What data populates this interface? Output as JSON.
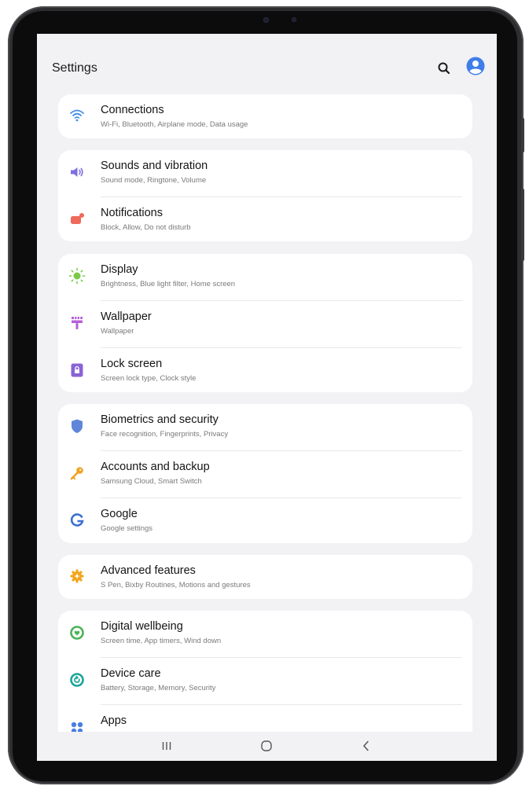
{
  "appbar": {
    "title": "Settings",
    "search_icon": "search-icon",
    "account_icon": "account-circle-icon"
  },
  "colors": {
    "screen_bg": "#f2f2f4",
    "card_bg": "#ffffff",
    "accent_blue": "#3f7ee8"
  },
  "groups": [
    {
      "items": [
        {
          "label": "Connections",
          "sub": "Wi-Fi, Bluetooth, Airplane mode, Data usage",
          "icon": "wifi-icon",
          "color": "#3f8ee8"
        }
      ]
    },
    {
      "items": [
        {
          "label": "Sounds and vibration",
          "sub": "Sound mode, Ringtone, Volume",
          "icon": "speaker-icon",
          "color": "#7d6fe0"
        },
        {
          "label": "Notifications",
          "sub": "Block, Allow, Do not disturb",
          "icon": "notification-icon",
          "color": "#ee6a5a"
        }
      ]
    },
    {
      "items": [
        {
          "label": "Display",
          "sub": "Brightness, Blue light filter, Home screen",
          "icon": "sun-icon",
          "color": "#7cc94a"
        },
        {
          "label": "Wallpaper",
          "sub": "Wallpaper",
          "icon": "brush-icon",
          "color": "#b45fd6"
        },
        {
          "label": "Lock screen",
          "sub": "Screen lock type, Clock style",
          "icon": "lock-icon",
          "color": "#8a63d6"
        }
      ]
    },
    {
      "items": [
        {
          "label": "Biometrics and security",
          "sub": "Face recognition, Fingerprints, Privacy",
          "icon": "shield-icon",
          "color": "#5f86d8"
        },
        {
          "label": "Accounts and backup",
          "sub": "Samsung Cloud, Smart Switch",
          "icon": "key-icon",
          "color": "#f1a21c"
        },
        {
          "label": "Google",
          "sub": "Google settings",
          "icon": "google-icon",
          "color": "#3c6fd1"
        }
      ]
    },
    {
      "items": [
        {
          "label": "Advanced features",
          "sub": "S Pen, Bixby Routines, Motions and gestures",
          "icon": "gear-plus-icon",
          "color": "#f2a51d"
        }
      ]
    },
    {
      "items": [
        {
          "label": "Digital wellbeing",
          "sub": "Screen time, App timers, Wind down",
          "icon": "wellbeing-icon",
          "color": "#4bb356"
        },
        {
          "label": "Device care",
          "sub": "Battery, Storage, Memory, Security",
          "icon": "device-care-icon",
          "color": "#1ba59a"
        },
        {
          "label": "Apps",
          "sub": "",
          "icon": "apps-grid-icon",
          "color": "#4a7fe0"
        }
      ]
    }
  ],
  "navbar": {
    "recents_icon": "recents-icon",
    "home_icon": "home-icon",
    "back_icon": "back-icon"
  }
}
